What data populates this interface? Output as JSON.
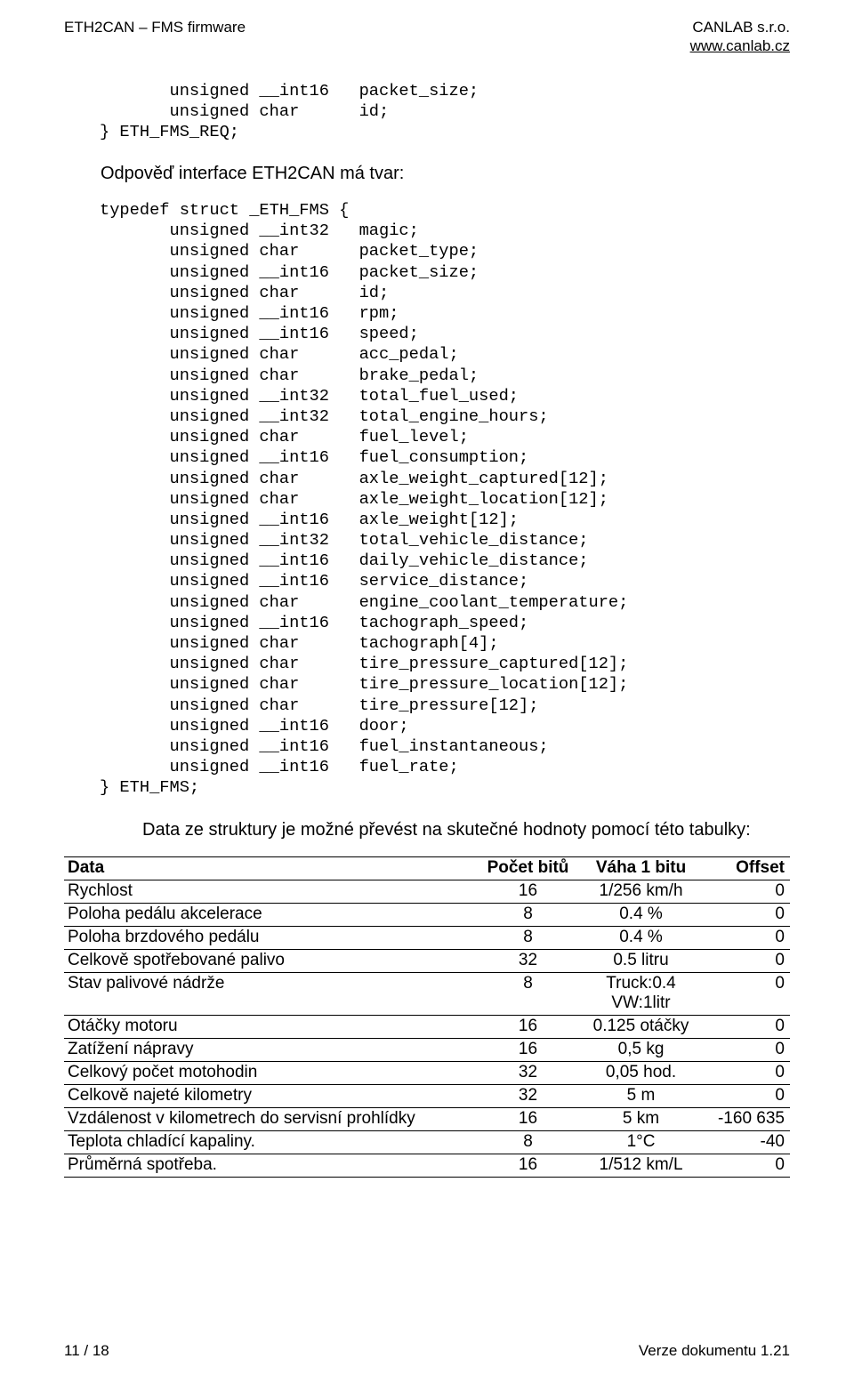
{
  "header": {
    "left": "ETH2CAN – FMS firmware",
    "right_line1": "CANLAB s.r.o.",
    "right_line2": "www.canlab.cz"
  },
  "codeblock1": "       unsigned __int16   packet_size;\n       unsigned char      id;\n} ETH_FMS_REQ;",
  "response_intro": "Odpověď interface ETH2CAN má tvar:",
  "codeblock2": "typedef struct _ETH_FMS {\n       unsigned __int32   magic;\n       unsigned char      packet_type;\n       unsigned __int16   packet_size;\n       unsigned char      id;\n       unsigned __int16   rpm;\n       unsigned __int16   speed;\n       unsigned char      acc_pedal;\n       unsigned char      brake_pedal;\n       unsigned __int32   total_fuel_used;\n       unsigned __int32   total_engine_hours;\n       unsigned char      fuel_level;\n       unsigned __int16   fuel_consumption;\n       unsigned char      axle_weight_captured[12];\n       unsigned char      axle_weight_location[12];\n       unsigned __int16   axle_weight[12];\n       unsigned __int32   total_vehicle_distance;\n       unsigned __int16   daily_vehicle_distance;\n       unsigned __int16   service_distance;\n       unsigned char      engine_coolant_temperature;\n       unsigned __int16   tachograph_speed;\n       unsigned char      tachograph[4];\n       unsigned char      tire_pressure_captured[12];\n       unsigned char      tire_pressure_location[12];\n       unsigned char      tire_pressure[12];\n       unsigned __int16   door;\n       unsigned __int16   fuel_instantaneous;\n       unsigned __int16   fuel_rate;\n} ETH_FMS;",
  "table_intro": "Data ze struktury je možné převést na skutečné hodnoty pomocí této tabulky:",
  "table": {
    "columns": [
      "Data",
      "Počet bitů",
      "Váha 1 bitu",
      "Offset"
    ],
    "rows": [
      {
        "data": "Rychlost",
        "bits": "16",
        "weight": "1/256 km/h",
        "offset": "0"
      },
      {
        "data": "Poloha pedálu akcelerace",
        "bits": "8",
        "weight": "0.4 %",
        "offset": "0"
      },
      {
        "data": "Poloha brzdového pedálu",
        "bits": "8",
        "weight": "0.4 %",
        "offset": "0"
      },
      {
        "data": "Celkově spotřebované palivo",
        "bits": "32",
        "weight": "0.5 litru",
        "offset": "0"
      },
      {
        "data": "Stav palivové nádrže",
        "bits": "8",
        "weight": "Truck:0.4\nVW:1litr",
        "offset": "0"
      },
      {
        "data": "Otáčky motoru",
        "bits": "16",
        "weight": "0.125 otáčky",
        "offset": "0"
      },
      {
        "data": "Zatížení nápravy",
        "bits": "16",
        "weight": "0,5 kg",
        "offset": "0"
      },
      {
        "data": "Celkový počet motohodin",
        "bits": "32",
        "weight": "0,05 hod.",
        "offset": "0"
      },
      {
        "data": "Celkově najeté kilometry",
        "bits": "32",
        "weight": "5 m",
        "offset": "0"
      },
      {
        "data": "Vzdálenost v kilometrech do servisní prohlídky",
        "bits": "16",
        "weight": "5 km",
        "offset": "-160 635"
      },
      {
        "data": "Teplota chladící kapaliny.",
        "bits": "8",
        "weight": "1°C",
        "offset": "-40"
      },
      {
        "data": "Průměrná  spotřeba.",
        "bits": "16",
        "weight": "1/512 km/L",
        "offset": "0"
      }
    ]
  },
  "footer": {
    "left": "11 / 18",
    "right": "Verze dokumentu 1.21"
  }
}
